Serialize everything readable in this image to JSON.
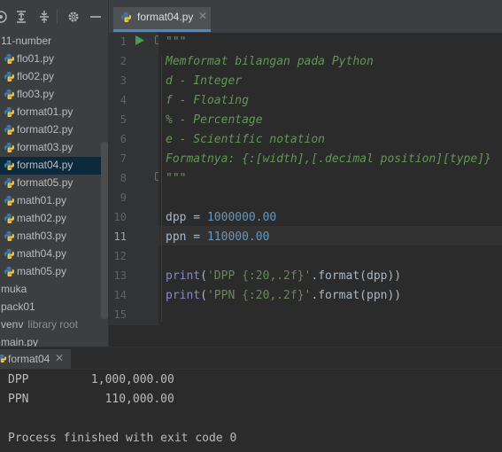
{
  "project_panel": {
    "toolbar_icons": [
      "target-icon",
      "expand-all-icon",
      "collapse-all-icon",
      "gear-icon",
      "minimize-icon"
    ],
    "items": [
      {
        "label": "11-number",
        "type": "folder"
      },
      {
        "label": "flo01.py",
        "type": "py"
      },
      {
        "label": "flo02.py",
        "type": "py"
      },
      {
        "label": "flo03.py",
        "type": "py"
      },
      {
        "label": "format01.py",
        "type": "py"
      },
      {
        "label": "format02.py",
        "type": "py"
      },
      {
        "label": "format03.py",
        "type": "py"
      },
      {
        "label": "format04.py",
        "type": "py",
        "selected": true
      },
      {
        "label": "format05.py",
        "type": "py"
      },
      {
        "label": "math01.py",
        "type": "py"
      },
      {
        "label": "math02.py",
        "type": "py"
      },
      {
        "label": "math03.py",
        "type": "py"
      },
      {
        "label": "math04.py",
        "type": "py"
      },
      {
        "label": "math05.py",
        "type": "py"
      },
      {
        "label": "muka",
        "type": "folder"
      },
      {
        "label": "pack01",
        "type": "folder"
      },
      {
        "label": "venv",
        "type": "folder",
        "sublabel": "library root"
      },
      {
        "label": "main.py",
        "type": "folder"
      }
    ]
  },
  "editor": {
    "tab_label": "format04.py",
    "tab_close": "✕",
    "current_line": 11,
    "line_numbers": [
      "1",
      "2",
      "3",
      "4",
      "5",
      "6",
      "7",
      "8",
      "9",
      "10",
      "11",
      "12",
      "13",
      "14",
      "15"
    ],
    "lines": {
      "l1": "\"\"\"",
      "l2": "Memformat bilangan pada Python",
      "l3": "d - Integer",
      "l4": "f - Floating",
      "l5": "% - Percentage",
      "l6": "e - Scientific notation",
      "l7": "Formatnya: {:[width],[.decimal position][type]}",
      "l8": "\"\"\"",
      "l10_var": "dpp",
      "l10_op": " = ",
      "l10_num": "1000000.00",
      "l11_var": "ppn",
      "l11_op": " = ",
      "l11_num": "110000.00",
      "l13_fn": "print",
      "l13_open": "(",
      "l13_str": "'DPP {:20,.2f}'",
      "l13_rest": ".format(dpp))",
      "l14_fn": "print",
      "l14_open": "(",
      "l14_str": "'PPN {:20,.2f}'",
      "l14_rest": ".format(ppn))"
    }
  },
  "run_panel": {
    "tab_label": "format04",
    "tab_close": "✕",
    "output": [
      "DPP         1,000,000.00",
      "PPN           110,000.00",
      "",
      "Process finished with exit code 0"
    ]
  },
  "colors": {
    "background": "#2b2b2b",
    "panel": "#3c3f41",
    "selection": "#0d293e",
    "docstring": "#629755",
    "string": "#6a8759",
    "number": "#6897bb",
    "builtin": "#8888c6",
    "text": "#a9b7c6",
    "tab_underline": "#4a88c7",
    "run_green": "#499c54"
  }
}
